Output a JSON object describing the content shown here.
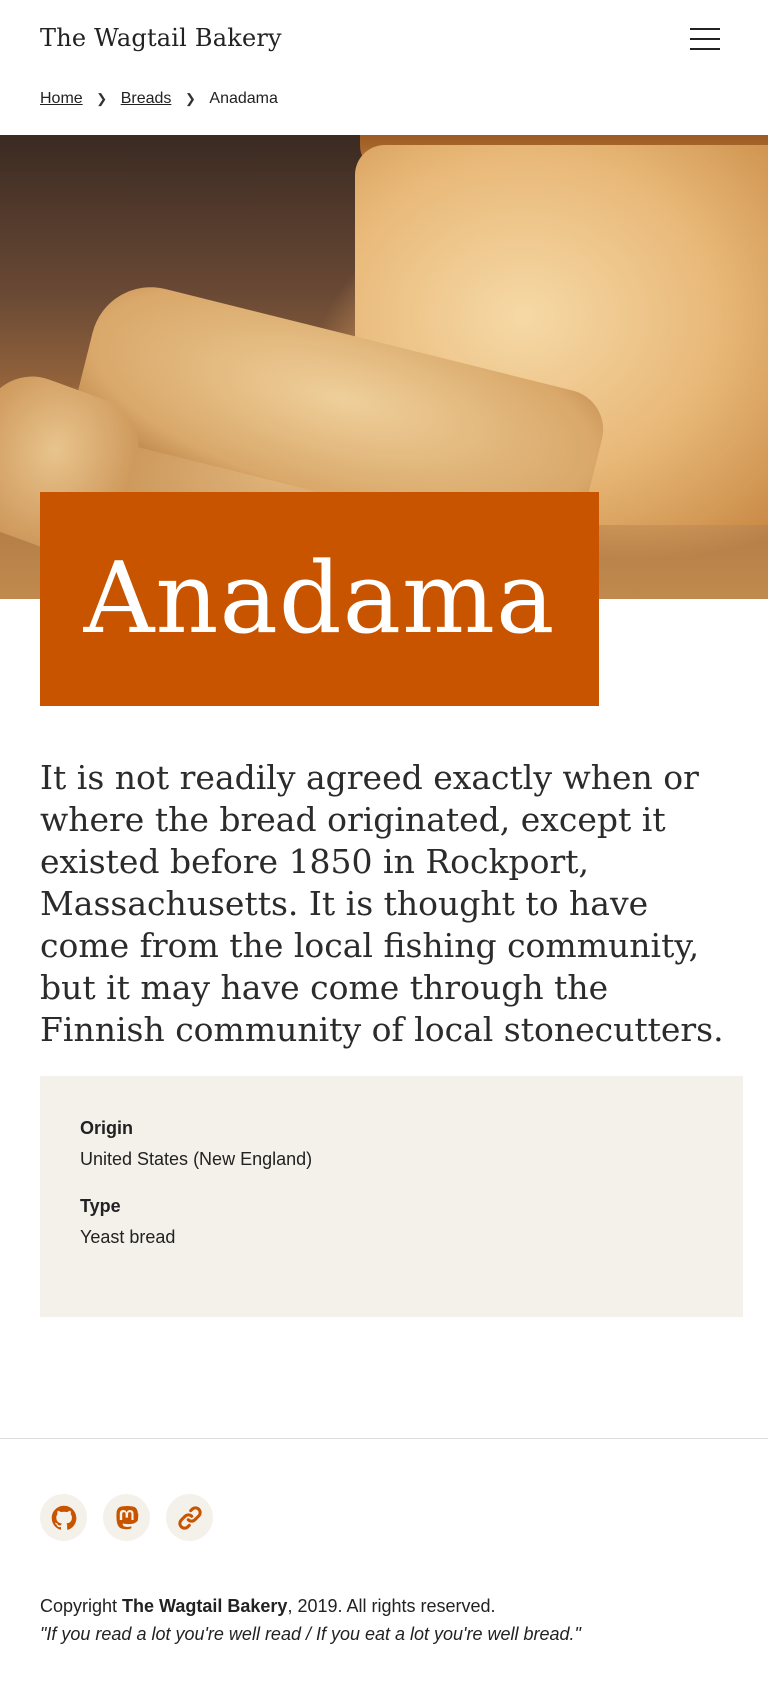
{
  "header": {
    "site_title": "The Wagtail Bakery"
  },
  "breadcrumb": {
    "items": [
      {
        "label": "Home"
      },
      {
        "label": "Breads"
      }
    ],
    "current": "Anadama"
  },
  "page": {
    "title": "Anadama",
    "intro": "It is not readily agreed exactly when or where the bread originated, except it existed before 1850 in Rockport, Massachusetts. It is thought to have come from the local fishing community, but it may have come through the Finnish community of local stonecutters."
  },
  "details": [
    {
      "label": "Origin",
      "value": "United States (New England)"
    },
    {
      "label": "Type",
      "value": "Yeast bread"
    }
  ],
  "footer": {
    "social": [
      {
        "icon": "github-icon"
      },
      {
        "icon": "mastodon-icon"
      },
      {
        "icon": "link-icon"
      }
    ],
    "copyright_prefix": "Copyright ",
    "copyright_brand": "The Wagtail Bakery",
    "copyright_suffix": ", 2019. All rights reserved.",
    "quote": "\"If you read a lot you're well read / If you eat a lot you're well bread.\""
  },
  "colors": {
    "accent": "#c85400",
    "panel": "#f4f1ea"
  }
}
